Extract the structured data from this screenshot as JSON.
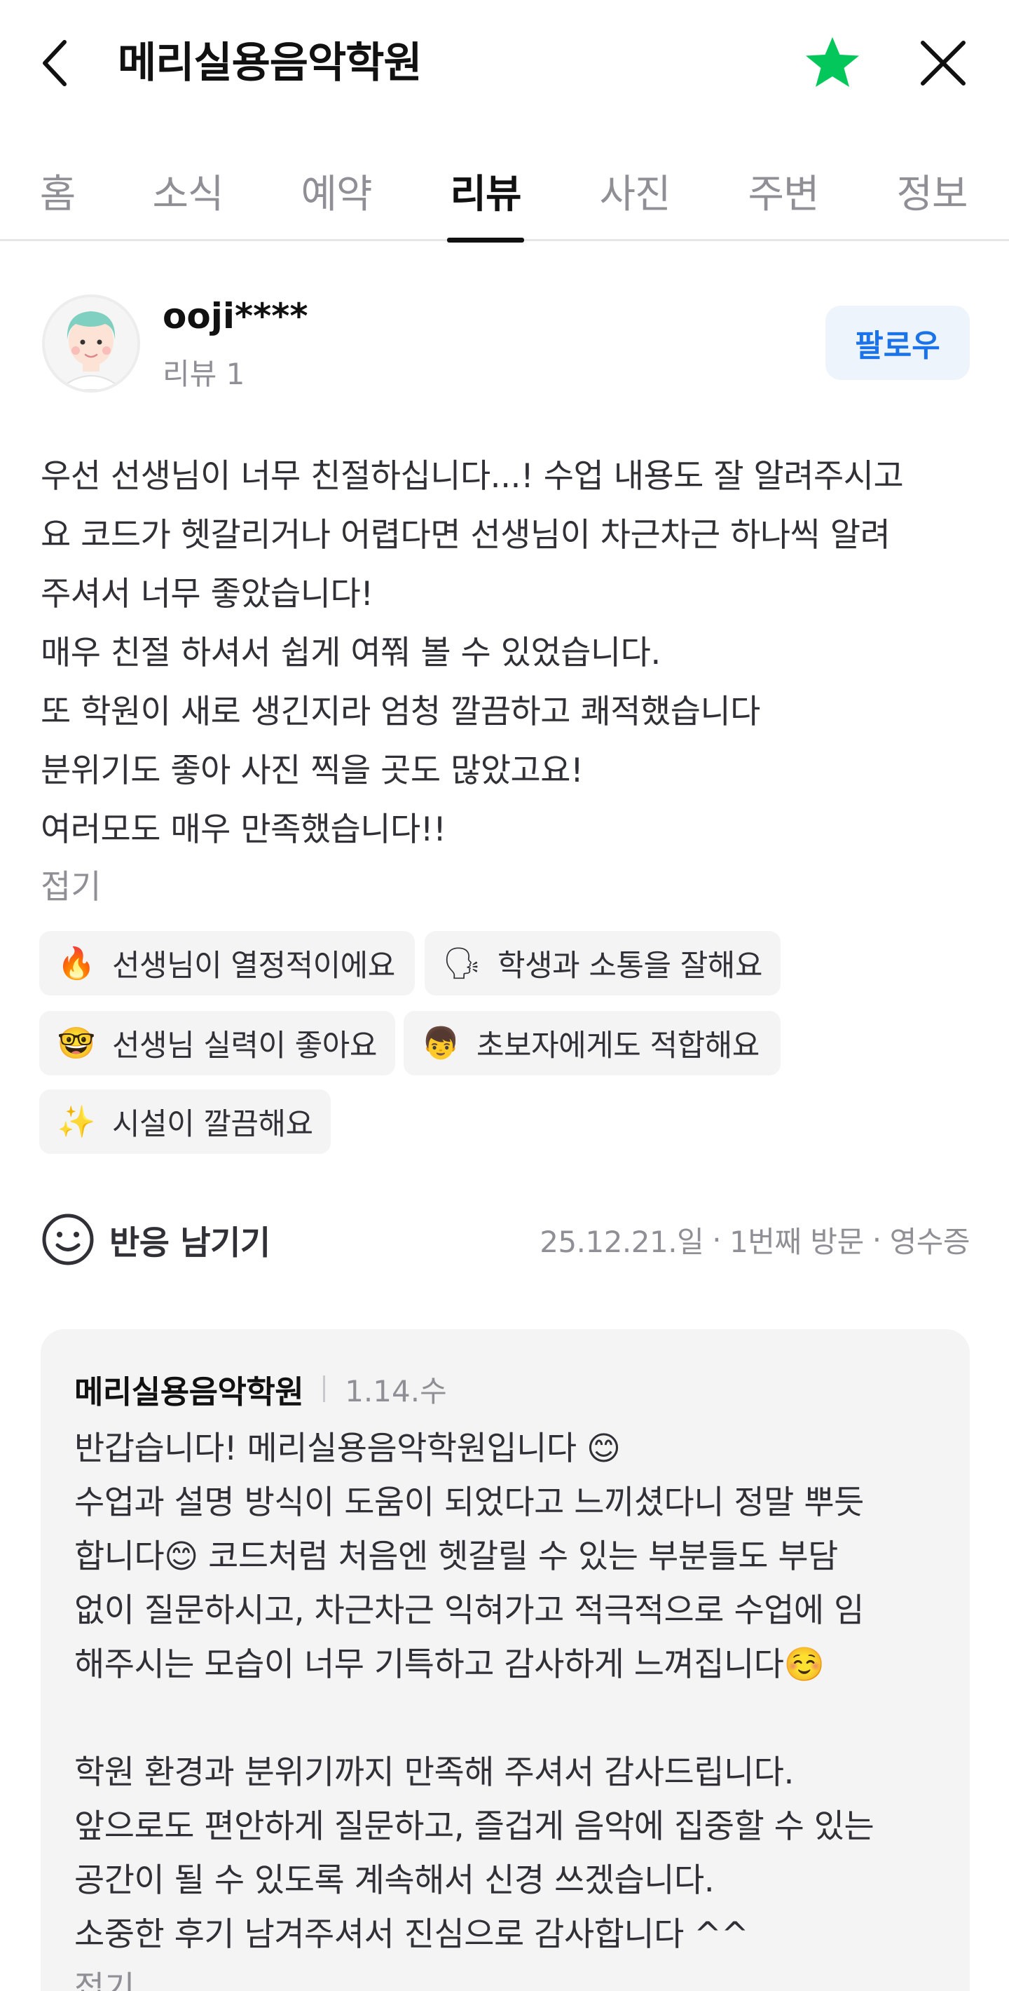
{
  "header": {
    "title": "메리실용음악학원"
  },
  "tabs": [
    "홈",
    "소식",
    "예약",
    "리뷰",
    "사진",
    "주변",
    "정보"
  ],
  "review": {
    "username": "ooji****",
    "review_count": "리뷰 1",
    "follow_label": "팔로우",
    "text_lines": [
      "우선 선생님이 너무 친절하십니다...! 수업 내용도 잘 알려주시고",
      "요 코드가 헷갈리거나 어렵다면 선생님이 차근차근 하나씩 알려",
      "주셔서 너무 좋았습니다!",
      "매우 친절 하셔서 쉽게 여쭤 볼 수 있었습니다.",
      "또 학원이 새로 생긴지라 엄청 깔끔하고 쾌적했습니다",
      "분위기도 좋아 사진 찍을 곳도 많았고요!",
      "여러모도 매우 만족했습니다!!"
    ],
    "collapse_label": "접기",
    "keywords": [
      {
        "emoji": "🔥",
        "label": "선생님이 열정적이에요"
      },
      {
        "emoji": "🗣",
        "label": "학생과 소통을 잘해요"
      },
      {
        "emoji": "🤓",
        "label": "선생님 실력이 좋아요"
      },
      {
        "emoji": "👦",
        "label": "초보자에게도 적합해요"
      },
      {
        "emoji": "✨",
        "label": "시설이 깔끔해요"
      }
    ],
    "reaction_label": "반응 남기기",
    "meta": {
      "date": "25.12.21.일",
      "visit": "1번째 방문",
      "proof": "영수증"
    }
  },
  "reply": {
    "name": "메리실용음악학원",
    "date": "1.14.수",
    "text_lines": [
      "반갑습니다! 메리실용음악학원입니다 😊",
      "수업과 설명 방식이 도움이 되었다고 느끼셨다니 정말 뿌듯",
      "합니다😊 코드처럼 처음엔 헷갈릴 수 있는 부분들도 부담",
      "없이 질문하시고, 차근차근 익혀가고 적극적으로 수업에 임",
      "해주시는 모습이 너무 기특하고 감사하게 느껴집니다☺️",
      "",
      "학원 환경과 분위기까지 만족해 주셔서 감사드립니다.",
      "앞으로도 편안하게 질문하고, 즐겁게 음악에 집중할 수 있는",
      "공간이 될 수 있도록 계속해서 신경 쓰겠습니다.",
      "소중한 후기 남겨주셔서 진심으로 감사합니다 ^^"
    ],
    "collapse_label": "접기"
  },
  "colors": {
    "star": "#03c75a",
    "follow_text": "#1a73e8",
    "follow_bg": "#eef4fc",
    "muted": "#8f8f95"
  }
}
